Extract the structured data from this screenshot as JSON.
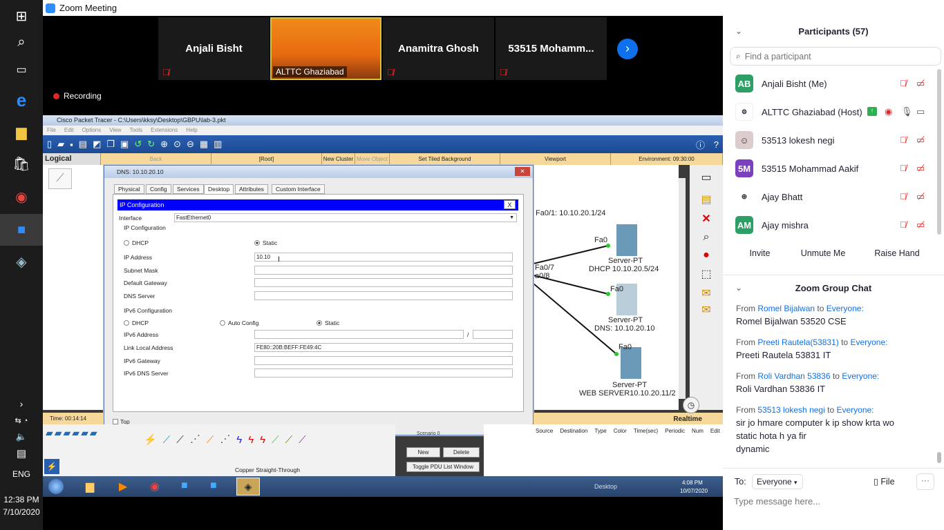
{
  "zoom": {
    "window_title": "Zoom Meeting",
    "recording": "Recording",
    "tiles": [
      {
        "name": "Anjali Bisht"
      },
      {
        "name": "ALTTC Ghaziabad"
      },
      {
        "name": "Anamitra Ghosh"
      },
      {
        "name": "53515  Mohamm..."
      }
    ]
  },
  "taskbar": {
    "lang": "ENG",
    "time": "12:38 PM",
    "date": "7/10/2020"
  },
  "pt": {
    "title": "Cisco Packet Tracer - C:\\Users\\kksy\\Desktop\\GBPU\\lab-3.pkt",
    "menu": [
      "File",
      "Edit",
      "Options",
      "View",
      "Tools",
      "Extensions",
      "Help"
    ],
    "nav": {
      "logical": "Logical",
      "back": "Back",
      "root": "[Root]",
      "new_cluster": "New Cluster",
      "move_object": "Move Object",
      "set_bg": "Set Tiled Background",
      "viewport": "Viewport",
      "environment": "Environment: 09:30:00"
    },
    "dialog": {
      "title": "DNS: 10.10.20.10",
      "tabs": [
        "Physical",
        "Config",
        "Services",
        "Desktop",
        "Attributes",
        "Custom Interface"
      ],
      "header": "IP Configuration",
      "close": "X",
      "interface_label": "Interface",
      "interface_value": "FastEthernet0",
      "ipconf_label": "IP Configuration",
      "dhcp": "DHCP",
      "static": "Static",
      "ip_label": "IP Address",
      "ip_value": "10.10",
      "mask_label": "Subnet Mask",
      "gw_label": "Default Gateway",
      "dns_label": "DNS Server",
      "ipv6_label": "IPv6 Configuration",
      "auto": "Auto Config",
      "ipv6_addr": "IPv6 Address",
      "ipv6_slash": "/",
      "link_label": "Link Local Address",
      "link_value": "FE80::20B:BEFF:FE49:4C",
      "ipv6_gw": "IPv6 Gateway",
      "ipv6_dns": "IPv6 DNS Server",
      "top": "Top"
    },
    "topo": {
      "fa01": "Fa0/1: 10.10.20.1/24",
      "fa0a": "Fa0",
      "srv1": "Server-PT",
      "dhcp": "DHCP 10.10.20.5/24",
      "fa07": "Fa0/7",
      "fa08": "a0/8",
      "fa0b": "Fa0",
      "srv2": "Server-PT",
      "dns": "DNS: 10.10.20.10",
      "fa0c": "Fa0",
      "srv3": "Server-PT",
      "web": "WEB SERVER10.10.20.11/2"
    },
    "bottom": {
      "time": "Time: 00:14:14",
      "realtime": "Realtime",
      "cable": "Copper Straight-Through",
      "scenario": "Scenario 0",
      "new": "New",
      "delete": "Delete",
      "toggle": "Toggle PDU List Window",
      "cols": [
        "Source",
        "Destination",
        "Type",
        "Color",
        "Time(sec)",
        "Periodic",
        "Num",
        "Edit"
      ]
    },
    "systray": {
      "desktop": "Desktop",
      "time": "4:08 PM",
      "date": "10/07/2020"
    }
  },
  "participants": {
    "title": "Participants (57)",
    "search_placeholder": "Find a participant",
    "list": [
      {
        "initials": "AB",
        "color": "#2e9e67",
        "name": "Anjali Bisht (Me)"
      },
      {
        "initials": "",
        "color": "#ffffff",
        "name": "ALTTC Ghaziabad (Host)"
      },
      {
        "initials": "",
        "color": "#ffffff",
        "name": "53513 lokesh negi"
      },
      {
        "initials": "5M",
        "color": "#7b3fbf",
        "name": "53515 Mohammad Aakif"
      },
      {
        "initials": "",
        "color": "#ffffff",
        "name": "Ajay Bhatt"
      },
      {
        "initials": "AM",
        "color": "#2e9e67",
        "name": "Ajay mishra"
      }
    ],
    "invite": "Invite",
    "unmute": "Unmute Me",
    "raise": "Raise Hand"
  },
  "chat": {
    "title": "Zoom Group Chat",
    "messages": [
      {
        "from": "Romel Bijalwan",
        "to": "Everyone:",
        "text": "Romel Bijalwan 53520 CSE"
      },
      {
        "from": "Preeti Rautela(53831)",
        "to": "Everyone:",
        "text": "Preeti Rautela 53831 IT"
      },
      {
        "from": "Roli Vardhan 53836",
        "to": "Everyone:",
        "text": "Roli Vardhan 53836 IT"
      },
      {
        "from": "53513 lokesh negi",
        "to": "Everyone:",
        "text": "sir jo hmare computer k ip show krta wo"
      }
    ],
    "extra_lines": [
      "static hota h ya fir",
      "dynamic"
    ],
    "from_word": "From",
    "to_word": "to",
    "to_label": "To:",
    "to_value": "Everyone",
    "file": "File",
    "placeholder": "Type message here..."
  }
}
